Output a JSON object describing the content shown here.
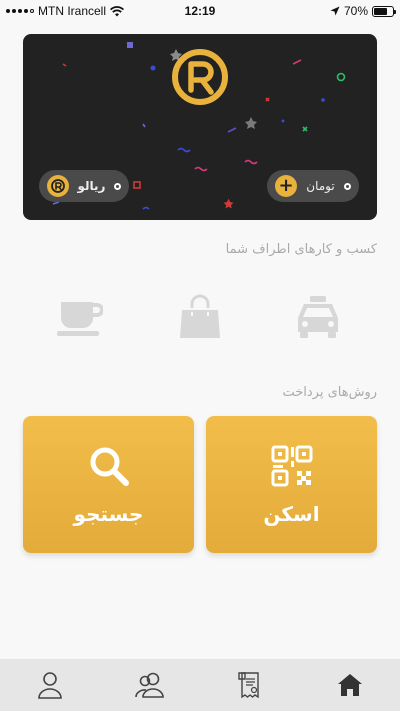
{
  "status_bar": {
    "carrier": "MTN Irancell",
    "time": "12:19",
    "battery": "70%",
    "icons": [
      "signal-icon",
      "wifi-icon",
      "location-arrow-icon",
      "battery-icon"
    ]
  },
  "wallet_card": {
    "logo": "rial-logo-icon",
    "rial_pill": {
      "label": "ریالو",
      "icon": "rial-coin-icon"
    },
    "toman_pill": {
      "label": "تومان",
      "icon": "plus-circle-icon"
    }
  },
  "business": {
    "title": "کسب و کارهای اطراف شما",
    "items": [
      {
        "name": "taxi",
        "icon": "taxi-icon"
      },
      {
        "name": "shop",
        "icon": "shopping-bag-icon"
      },
      {
        "name": "cafe",
        "icon": "coffee-cup-icon"
      }
    ]
  },
  "payment": {
    "title": "روش‌های پرداخت",
    "scan_label": "اسکن",
    "search_label": "جستجو"
  },
  "bottom_nav": {
    "items": [
      {
        "name": "profile",
        "icon": "person-icon"
      },
      {
        "name": "contacts",
        "icon": "people-icon"
      },
      {
        "name": "transactions",
        "icon": "receipt-icon"
      },
      {
        "name": "home",
        "icon": "home-icon"
      }
    ]
  },
  "colors": {
    "accent": "#e8b23c",
    "card_bg": "#222222",
    "muted_icon": "#d7d7d7",
    "nav_bg": "#e6e6e6"
  }
}
